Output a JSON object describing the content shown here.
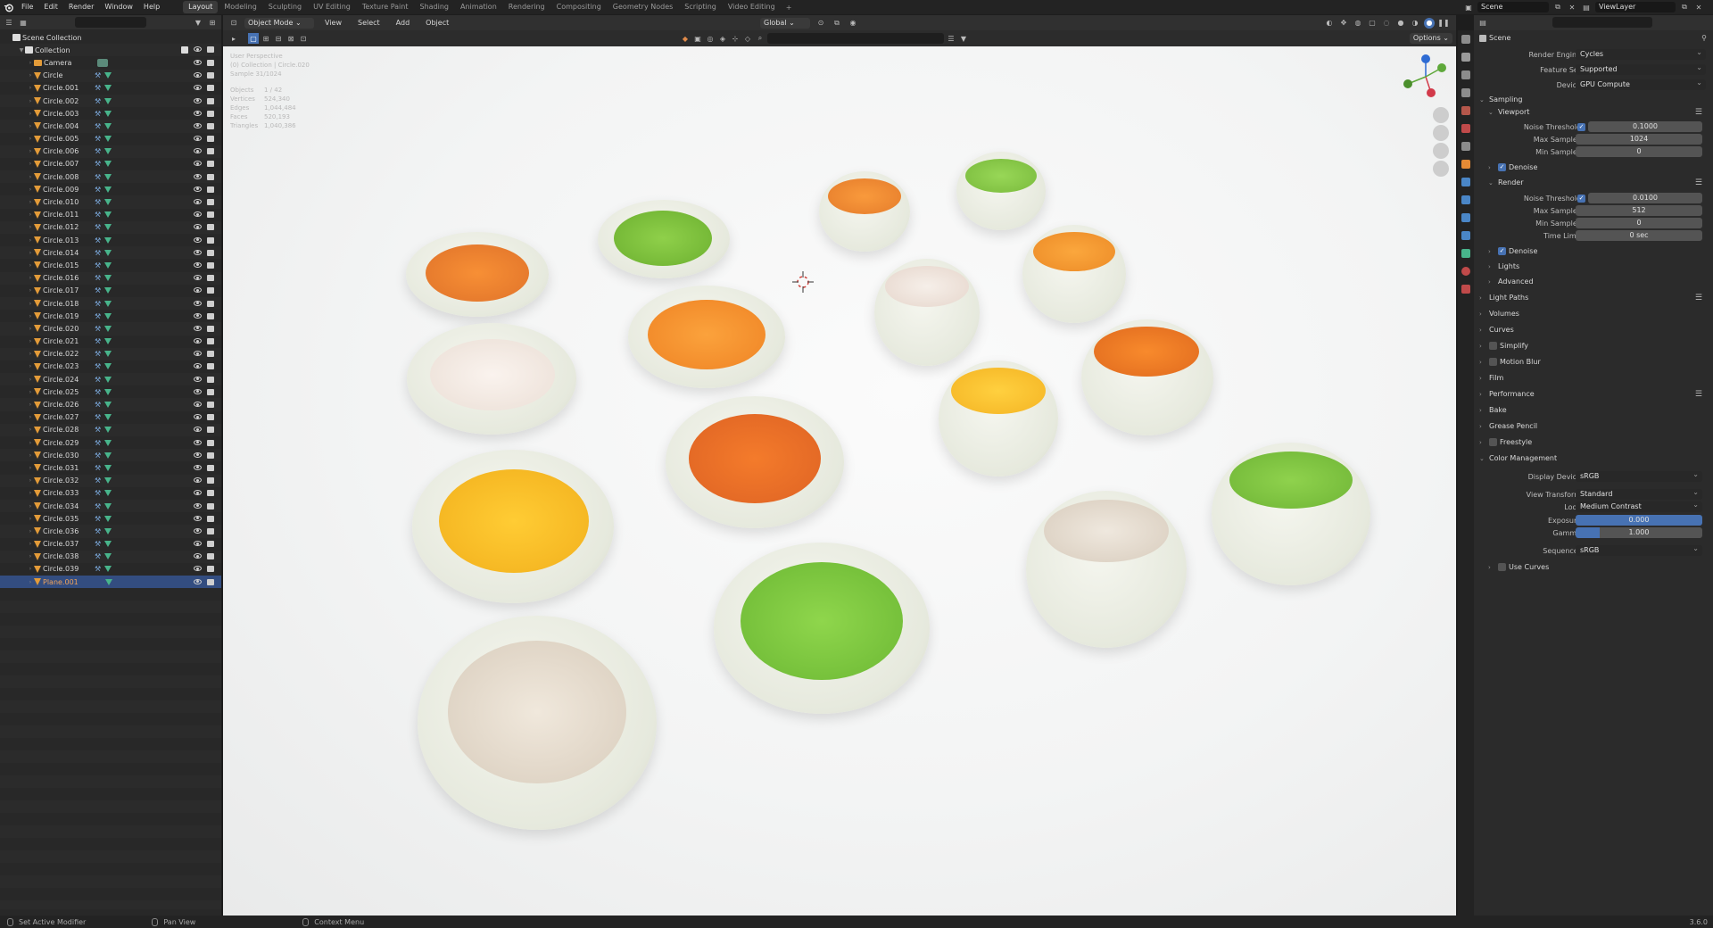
{
  "topbar": {
    "menus": [
      "File",
      "Edit",
      "Render",
      "Window",
      "Help"
    ],
    "workspaces": [
      "Layout",
      "Modeling",
      "Sculpting",
      "UV Editing",
      "Texture Paint",
      "Shading",
      "Animation",
      "Rendering",
      "Compositing",
      "Geometry Nodes",
      "Scripting",
      "Video Editing"
    ],
    "active_workspace": "Layout",
    "add_tab": "+",
    "scene": "Scene",
    "view_layer": "ViewLayer"
  },
  "outliner": {
    "scene_collection": "Scene Collection",
    "collection": "Collection",
    "objects": [
      "Camera",
      "Circle",
      "Circle.001",
      "Circle.002",
      "Circle.003",
      "Circle.004",
      "Circle.005",
      "Circle.006",
      "Circle.007",
      "Circle.008",
      "Circle.009",
      "Circle.010",
      "Circle.011",
      "Circle.012",
      "Circle.013",
      "Circle.014",
      "Circle.015",
      "Circle.016",
      "Circle.017",
      "Circle.018",
      "Circle.019",
      "Circle.020",
      "Circle.021",
      "Circle.022",
      "Circle.023",
      "Circle.024",
      "Circle.025",
      "Circle.026",
      "Circle.027",
      "Circle.028",
      "Circle.029",
      "Circle.030",
      "Circle.031",
      "Circle.032",
      "Circle.033",
      "Circle.034",
      "Circle.035",
      "Circle.036",
      "Circle.037",
      "Circle.038",
      "Circle.039",
      "Plane.001"
    ],
    "selected": "Plane.001"
  },
  "viewport": {
    "mode": "Object Mode",
    "menus": [
      "View",
      "Select",
      "Add",
      "Object"
    ],
    "transform": "Global",
    "options": "Options",
    "hud": {
      "line1": "User Perspective",
      "line2": "(0) Collection | Circle.020",
      "line3": "Sample 31/1024",
      "stats": [
        {
          "k": "Objects",
          "v": "1 / 42"
        },
        {
          "k": "Vertices",
          "v": "524,340"
        },
        {
          "k": "Edges",
          "v": "1,044,484"
        },
        {
          "k": "Faces",
          "v": "520,193"
        },
        {
          "k": "Triangles",
          "v": "1,040,386"
        }
      ]
    },
    "gizmo": {
      "x": "X",
      "y": "Y",
      "z": "Z"
    }
  },
  "properties": {
    "title": "Scene",
    "render_engine_label": "Render Engine",
    "render_engine": "Cycles",
    "feature_set_label": "Feature Set",
    "feature_set": "Supported",
    "device_label": "Device",
    "device": "GPU Compute",
    "sampling": "Sampling",
    "viewport": "Viewport",
    "noise_threshold_label": "Noise Threshold",
    "vp_noise_threshold": "0.1000",
    "max_samples_label": "Max Samples",
    "vp_max_samples": "1024",
    "min_samples_label": "Min Samples",
    "vp_min_samples": "0",
    "denoise": "Denoise",
    "render": "Render",
    "r_noise_threshold": "0.0100",
    "r_max_samples": "512",
    "r_min_samples": "0",
    "time_limit_label": "Time Limit",
    "time_limit": "0 sec",
    "lights": "Lights",
    "advanced": "Advanced",
    "light_paths": "Light Paths",
    "volumes": "Volumes",
    "curves": "Curves",
    "simplify": "Simplify",
    "motion_blur": "Motion Blur",
    "film": "Film",
    "performance": "Performance",
    "bake": "Bake",
    "grease_pencil": "Grease Pencil",
    "freestyle": "Freestyle",
    "color_management": "Color Management",
    "display_device_label": "Display Device",
    "display_device": "sRGB",
    "view_transform_label": "View Transform",
    "view_transform": "Standard",
    "look_label": "Look",
    "look": "Medium Contrast",
    "exposure_label": "Exposure",
    "exposure": "0.000",
    "gamma_label": "Gamma",
    "gamma": "1.000",
    "sequencer_label": "Sequencer",
    "sequencer": "sRGB",
    "use_curves": "Use Curves"
  },
  "statusbar": {
    "left": "Set Active Modifier",
    "mid": "Pan View",
    "right": "Context Menu",
    "version": "3.6.0"
  },
  "colors": {
    "accent": "#4772b3",
    "selection": "#334d80",
    "mesh": "#e39b39"
  }
}
